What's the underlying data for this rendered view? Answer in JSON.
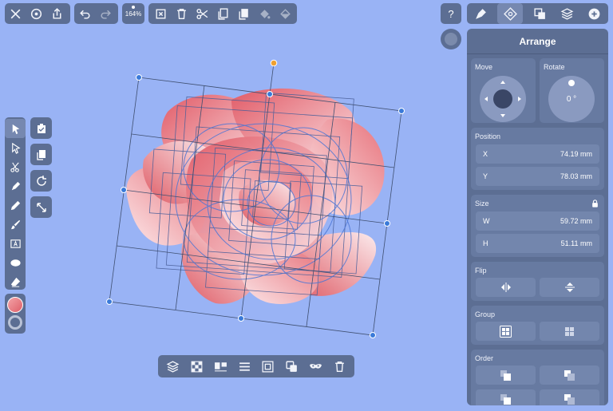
{
  "toolbar": {
    "zoom_label": "164%"
  },
  "help_label": "?",
  "panel": {
    "title": "Arrange",
    "move_label": "Move",
    "rotate_label": "Rotate",
    "rotate_value": "0 °",
    "position_label": "Position",
    "x_label": "X",
    "x_value": "74.19 mm",
    "y_label": "Y",
    "y_value": "78.03 mm",
    "size_label": "Size",
    "w_label": "W",
    "w_value": "59.72 mm",
    "h_label": "H",
    "h_value": "51.11 mm",
    "flip_label": "Flip",
    "group_label": "Group",
    "order_label": "Order"
  },
  "colors": {
    "background": "#99b3f5",
    "toolbar": "#5c6e93",
    "fill_swatch": "#e8878d",
    "handle": "#3a7ad9",
    "rotate_handle": "#f0a030",
    "petal_light": "#fde6e8",
    "petal_dark": "#e2616a"
  }
}
